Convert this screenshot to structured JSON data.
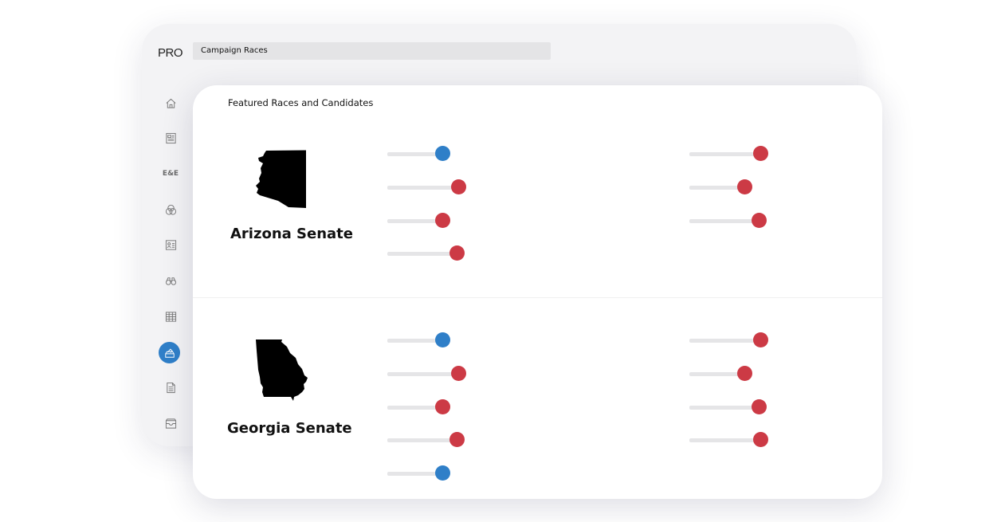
{
  "app": {
    "logo": "PRO",
    "search_text": "Campaign Races"
  },
  "sidebar": {
    "items": [
      {
        "icon": "home-icon",
        "active": false
      },
      {
        "icon": "newspaper-icon",
        "active": false
      },
      {
        "icon": "eae-icon",
        "label": "E&E",
        "active": false
      },
      {
        "icon": "venn-icon",
        "active": false
      },
      {
        "icon": "id-card-icon",
        "active": false
      },
      {
        "icon": "binoculars-icon",
        "active": false
      },
      {
        "icon": "table-icon",
        "active": false
      },
      {
        "icon": "ballot-box-icon",
        "active": true
      },
      {
        "icon": "document-icon",
        "active": false
      },
      {
        "icon": "inbox-icon",
        "active": false
      }
    ]
  },
  "colors": {
    "democrat": "#2f7fc8",
    "republican": "#cc3a45",
    "active_nav": "#2f7fc8"
  },
  "panel": {
    "title": "Featured Races and Candidates",
    "races": [
      {
        "name": "Arizona Senate",
        "left_candidates": [
          {
            "party": "democrat"
          },
          {
            "party": "republican"
          },
          {
            "party": "republican"
          },
          {
            "party": "republican"
          }
        ],
        "right_candidates": [
          {
            "party": "republican"
          },
          {
            "party": "republican"
          },
          {
            "party": "republican"
          }
        ]
      },
      {
        "name": "Georgia Senate",
        "left_candidates": [
          {
            "party": "democrat"
          },
          {
            "party": "republican"
          },
          {
            "party": "republican"
          },
          {
            "party": "republican"
          },
          {
            "party": "democrat"
          }
        ],
        "right_candidates": [
          {
            "party": "republican"
          },
          {
            "party": "republican"
          },
          {
            "party": "republican"
          },
          {
            "party": "republican"
          }
        ]
      }
    ]
  }
}
